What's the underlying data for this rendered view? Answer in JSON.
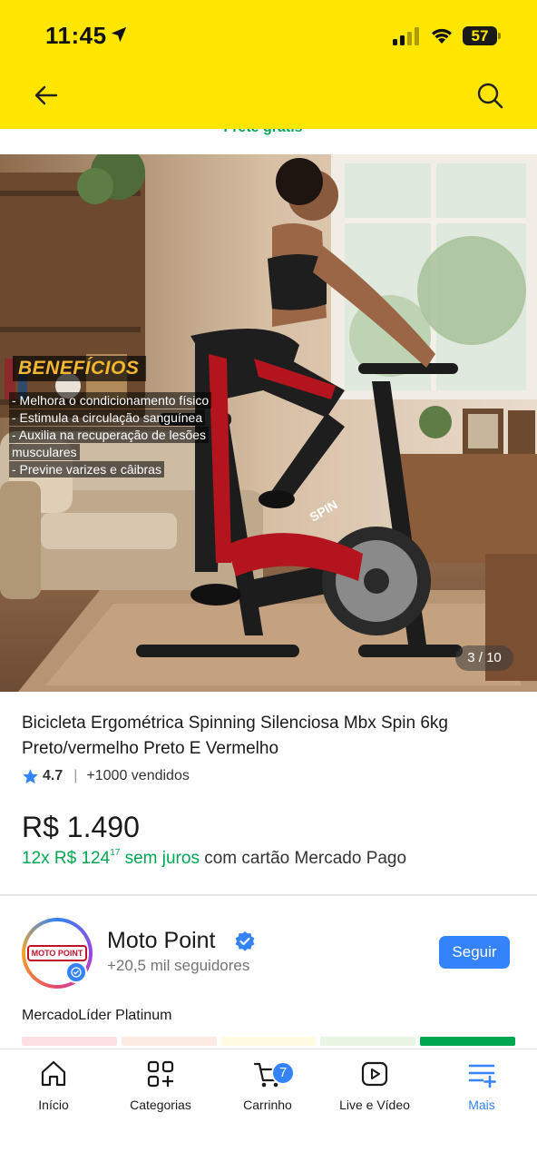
{
  "status_bar": {
    "time": "11:45",
    "battery": "57"
  },
  "header": {
    "back_icon": "arrow-left-icon",
    "search_icon": "search-icon"
  },
  "shipping_note": "Frete grátis",
  "gallery": {
    "overlay_title": "BENEFÍCIOS",
    "overlay_lines": [
      "- Melhora o condicionamento físico",
      "- Estimula a circulação sanguínea",
      "- Auxilia na recuperação de lesões",
      "musculares",
      "- Previne varizes e câibras"
    ],
    "bike_text": "SPIN",
    "counter": "3 / 10"
  },
  "product": {
    "title": "Bicicleta Ergométrica Spinning Silenciosa Mbx Spin 6kg Preto/vermelho Preto E Vermelho",
    "rating": "4.7",
    "sold": "+1000 vendidos",
    "price": "R$ 1.490",
    "installments_prefix": "12x R$ 124",
    "installments_cents": "17",
    "installments_interest": " sem juros",
    "installments_suffix": " com cartão Mercado Pago"
  },
  "seller": {
    "logo_text": "MOTO POINT",
    "name": "Moto Point",
    "followers": "+20,5 mil seguidores",
    "follow_label": "Seguir",
    "level": "MercadoLíder Platinum",
    "thermometer_colors": [
      "#fbe0e3",
      "#fdece4",
      "#fefbe0",
      "#e8f6e3",
      "#00a650"
    ]
  },
  "colors": {
    "brand_yellow": "#ffe600",
    "accent_blue": "#3483fa",
    "green": "#00a650"
  },
  "bottom_nav": {
    "items": [
      {
        "label": "Início",
        "icon": "home-icon"
      },
      {
        "label": "Categorias",
        "icon": "categories-icon"
      },
      {
        "label": "Carrinho",
        "icon": "cart-icon",
        "badge": "7"
      },
      {
        "label": "Live e Vídeo",
        "icon": "play-icon"
      },
      {
        "label": "Mais",
        "icon": "menu-plus-icon",
        "active": true
      }
    ]
  }
}
